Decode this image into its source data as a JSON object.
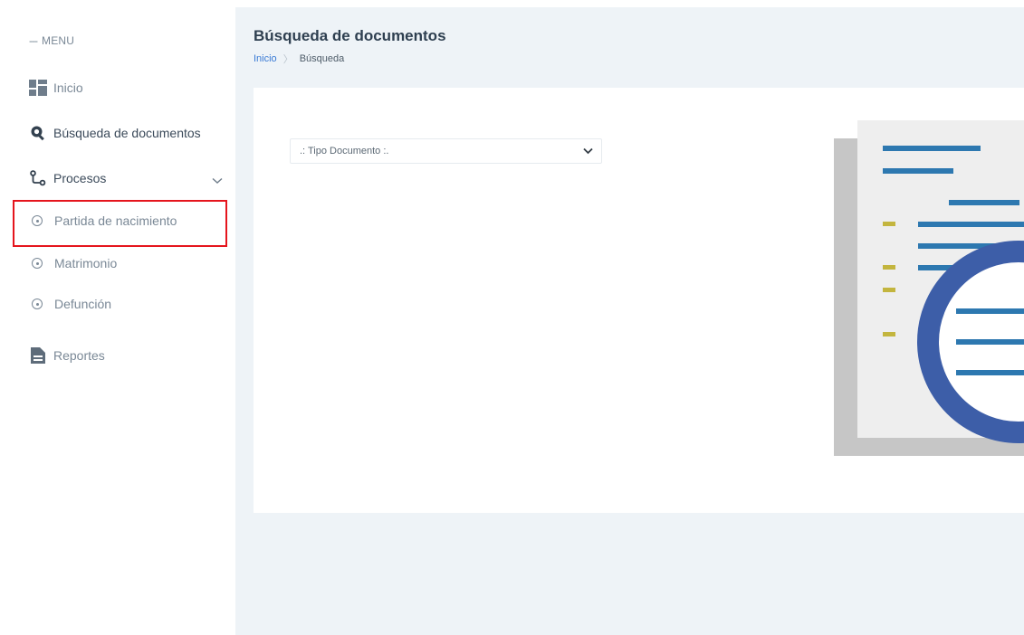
{
  "sidebar": {
    "menu_header": "MENU",
    "items": [
      {
        "label": "Inicio",
        "icon": "dashboard-icon"
      },
      {
        "label": "Búsqueda de documentos",
        "icon": "search-document-icon"
      },
      {
        "label": "Procesos",
        "icon": "process-flow-icon",
        "expanded": true,
        "children": [
          {
            "label": "Partida de nacimiento",
            "highlighted": true
          },
          {
            "label": "Matrimonio"
          },
          {
            "label": "Defunción"
          }
        ]
      },
      {
        "label": "Reportes",
        "icon": "report-file-icon"
      }
    ]
  },
  "header": {
    "title": "Búsqueda de documentos",
    "breadcrumb": {
      "home": "Inicio",
      "current": "Búsqueda"
    }
  },
  "main": {
    "document_type_select": {
      "value": ".: Tipo Documento :."
    }
  },
  "colors": {
    "accent": "#3a7bd5",
    "highlight_border": "#e5151d",
    "illustration_blue": "#2d78b0",
    "illustration_ring": "#3d5ea8",
    "illustration_yellow": "#c3b53e"
  }
}
